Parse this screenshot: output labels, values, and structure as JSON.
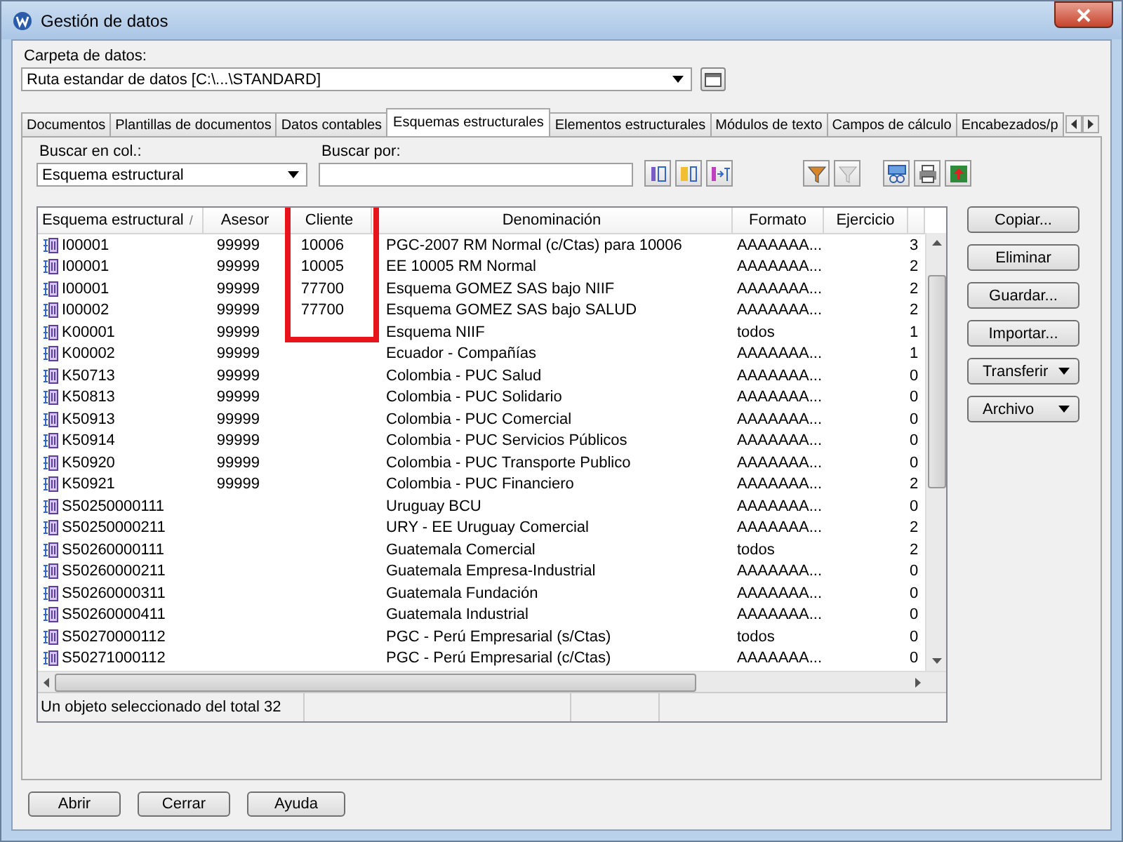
{
  "window": {
    "title": "Gestión de datos"
  },
  "folder": {
    "label": "Carpeta de datos:",
    "value": "Ruta estandar de datos [C:\\...\\STANDARD]"
  },
  "tabs": [
    {
      "label": "Documentos",
      "selected": false
    },
    {
      "label": "Plantillas de documentos",
      "selected": false
    },
    {
      "label": "Datos contables",
      "selected": false
    },
    {
      "label": "Esquemas estructurales",
      "selected": true
    },
    {
      "label": "Elementos estructurales",
      "selected": false
    },
    {
      "label": "Módulos de texto",
      "selected": false
    },
    {
      "label": "Campos de cálculo",
      "selected": false
    },
    {
      "label": "Encabezados/p",
      "selected": false
    }
  ],
  "search": {
    "column_label": "Buscar en col.:",
    "column_value": "Esquema estructural",
    "query_label": "Buscar por:"
  },
  "table": {
    "columns": [
      "Esquema estructural",
      "Asesor",
      "Cliente",
      "Denominación",
      "Formato",
      "Ejercicio"
    ],
    "sort_mark": "/",
    "rows": [
      {
        "id": "I00001",
        "asesor": "99999",
        "cliente": "10006",
        "name": "PGC-2007 RM Normal (c/Ctas) para 10006",
        "formato": "AAAAAAA...",
        "column_7": "3"
      },
      {
        "id": "I00001",
        "asesor": "99999",
        "cliente": "10005",
        "name": "EE 10005 RM Normal",
        "formato": "AAAAAAA...",
        "column_7": "2"
      },
      {
        "id": "I00001",
        "asesor": "99999",
        "cliente": "77700",
        "name": "Esquema GOMEZ SAS bajo NIIF",
        "formato": "AAAAAAA...",
        "column_7": "2"
      },
      {
        "id": "I00002",
        "asesor": "99999",
        "cliente": "77700",
        "name": "Esquema GOMEZ SAS bajo SALUD",
        "formato": "AAAAAAA...",
        "column_7": "2"
      },
      {
        "id": "K00001",
        "asesor": "99999",
        "name": "Esquema NIIF",
        "formato": "todos",
        "column_7": "1"
      },
      {
        "id": "K00002",
        "asesor": "99999",
        "name": "Ecuador - Compañías",
        "formato": "AAAAAAA...",
        "column_7": "1"
      },
      {
        "id": "K50713",
        "asesor": "99999",
        "name": "Colombia - PUC Salud",
        "formato": "AAAAAAA...",
        "column_7": "0"
      },
      {
        "id": "K50813",
        "asesor": "99999",
        "name": "Colombia - PUC Solidario",
        "formato": "AAAAAAA...",
        "column_7": "0"
      },
      {
        "id": "K50913",
        "asesor": "99999",
        "name": "Colombia - PUC Comercial",
        "formato": "AAAAAAA...",
        "column_7": "0"
      },
      {
        "id": "K50914",
        "asesor": "99999",
        "name": "Colombia - PUC Servicios Públicos",
        "formato": "AAAAAAA...",
        "column_7": "0"
      },
      {
        "id": "K50920",
        "asesor": "99999",
        "name": "Colombia - PUC Transporte Publico",
        "formato": "AAAAAAA...",
        "column_7": "0"
      },
      {
        "id": "K50921",
        "asesor": "99999",
        "name": "Colombia - PUC Financiero",
        "formato": "AAAAAAA...",
        "column_7": "2"
      },
      {
        "id": "S50250000111",
        "name": "Uruguay BCU",
        "formato": "AAAAAAA...",
        "column_7": "0"
      },
      {
        "id": "S50250000211",
        "name": "URY - EE Uruguay Comercial",
        "formato": "AAAAAAA...",
        "column_7": "2"
      },
      {
        "id": "S50260000111",
        "name": "Guatemala Comercial",
        "formato": "todos",
        "column_7": "2"
      },
      {
        "id": "S50260000211",
        "name": "Guatemala Empresa-Industrial",
        "formato": "AAAAAAA...",
        "column_7": "0"
      },
      {
        "id": "S50260000311",
        "name": "Guatemala Fundación",
        "formato": "AAAAAAA...",
        "column_7": "0"
      },
      {
        "id": "S50260000411",
        "name": "Guatemala Industrial",
        "formato": "AAAAAAA...",
        "column_7": "0"
      },
      {
        "id": "S50270000112",
        "name": "PGC - Perú Empresarial (s/Ctas)",
        "formato": "todos",
        "column_7": "0"
      },
      {
        "id": "S50271000112",
        "name": "PGC - Perú Empresarial (c/Ctas)",
        "formato": "AAAAAAA...",
        "column_7": "0"
      }
    ]
  },
  "status_bar": "Un objeto seleccionado del total 32",
  "side_buttons": [
    {
      "label": "Copiar...",
      "kind": "plain"
    },
    {
      "label": "Eliminar",
      "kind": "plain"
    },
    {
      "label": "Guardar...",
      "kind": "plain"
    },
    {
      "label": "Importar...",
      "kind": "plain"
    },
    {
      "label": "Transferir",
      "kind": "menu"
    },
    {
      "label": "Archivo",
      "kind": "menu"
    }
  ],
  "bottom_buttons": [
    "Abrir",
    "Cerrar",
    "Ayuda"
  ]
}
